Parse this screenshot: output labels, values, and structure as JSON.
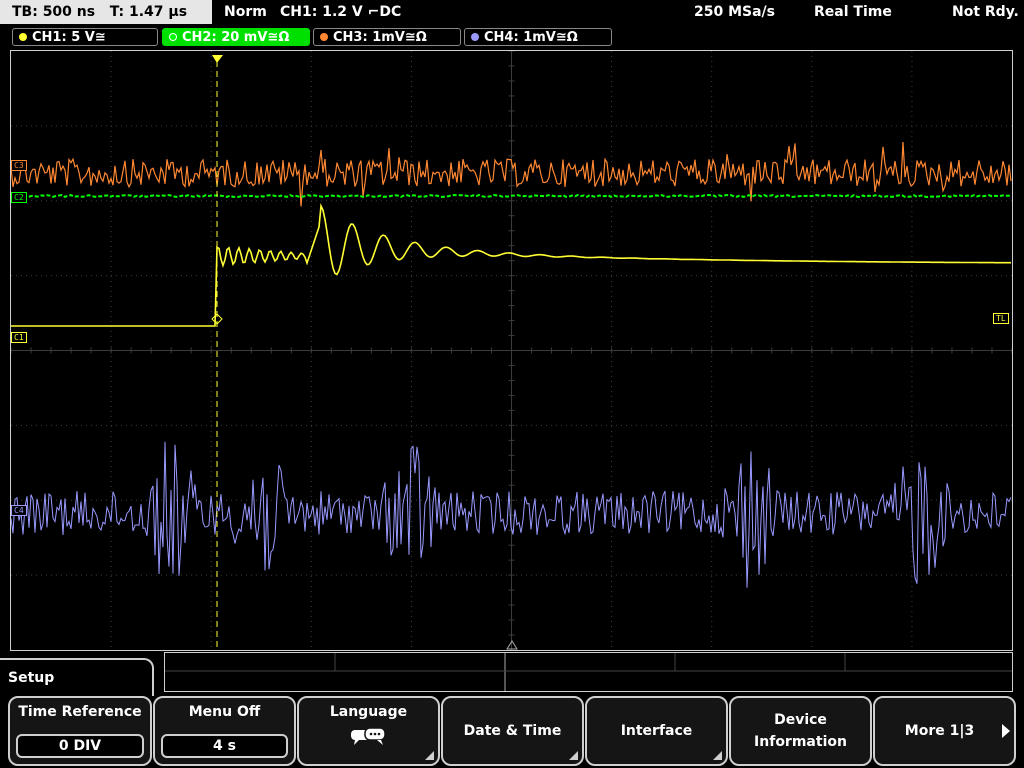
{
  "status_bar": {
    "timebase": "TB: 500 ns",
    "trigger_time": "T: 1.47 µs",
    "trigger_mode": "Norm",
    "trigger_level": "CH1: 1.2 V",
    "trigger_coupling": "DC",
    "sample_rate": "250 MSa/s",
    "acq_mode": "Real Time",
    "acq_status": "Not Rdy."
  },
  "channels": [
    {
      "label": "CH1: 5 V",
      "suffix": "≅",
      "color": "#ffff33",
      "active": false
    },
    {
      "label": "CH2: 20 mV",
      "suffix": "≅Ω",
      "color": "#00ff00",
      "active": true
    },
    {
      "label": "CH3: 1mV",
      "suffix": "≅Ω",
      "color": "#ff8833",
      "active": false
    },
    {
      "label": "CH4: 1mV",
      "suffix": "≅Ω",
      "color": "#9999ff",
      "active": false
    }
  ],
  "markers": {
    "ch1": "C1",
    "ch2": "C2",
    "ch3": "C3",
    "ch4": "C4",
    "trigger_level": "TL",
    "trigger_pos": "T"
  },
  "menu": {
    "title": "Setup",
    "softkeys": [
      {
        "label": "Time Reference",
        "value": "0 DIV"
      },
      {
        "label": "Menu Off",
        "value": "4 s"
      },
      {
        "label": "Language",
        "icon": "speech-bubble-icon"
      },
      {
        "label": "Date & Time"
      },
      {
        "label": "Interface"
      },
      {
        "label": "Device",
        "label2": "Information"
      },
      {
        "label": "More 1|3"
      }
    ]
  },
  "colors": {
    "ch1": "#ffff33",
    "ch2": "#00ff00",
    "ch3": "#ff8833",
    "ch4": "#9999ff",
    "grid": "#3c3c3c"
  }
}
